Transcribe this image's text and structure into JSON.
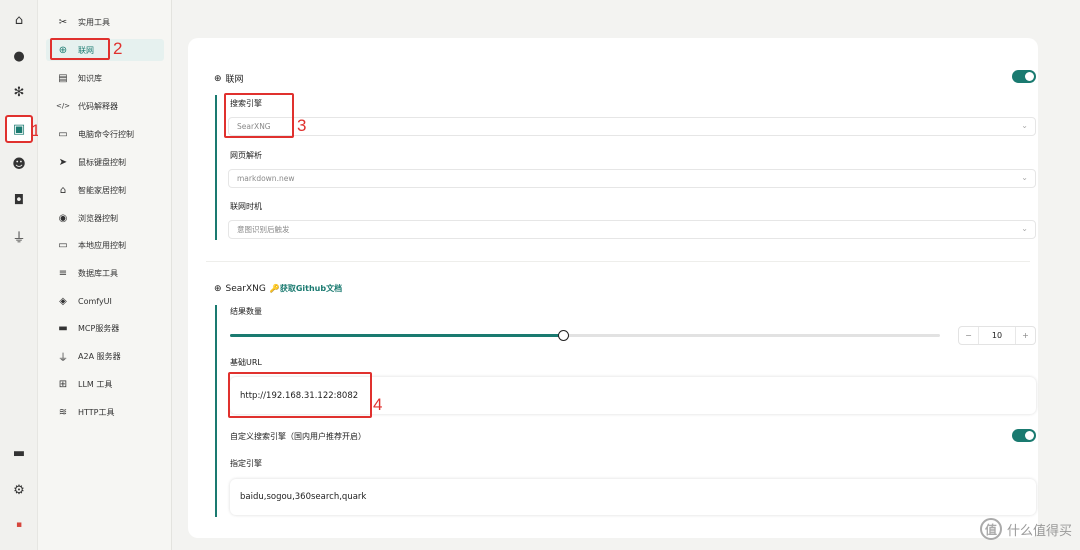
{
  "rail": {
    "items": [
      {
        "name": "home-icon",
        "glyph": "⌂"
      },
      {
        "name": "chat-icon",
        "glyph": "●"
      },
      {
        "name": "settings-snowflake-icon",
        "glyph": "✻"
      },
      {
        "name": "toolbox-icon",
        "glyph": "▣"
      },
      {
        "name": "theater-mask-icon",
        "glyph": "☻"
      },
      {
        "name": "robot-icon",
        "glyph": "◘"
      },
      {
        "name": "plug-icon",
        "glyph": "⏚"
      },
      {
        "name": "archive-icon",
        "glyph": "▬"
      },
      {
        "name": "gear-icon",
        "glyph": "⚙"
      },
      {
        "name": "app-logo-icon",
        "glyph": "▪"
      }
    ]
  },
  "sidebar": {
    "items": [
      {
        "label": "实用工具",
        "icon": "✂"
      },
      {
        "label": "联网",
        "icon": "⊕"
      },
      {
        "label": "知识库",
        "icon": "▤"
      },
      {
        "label": "代码解释器",
        "icon": "</>"
      },
      {
        "label": "电脑命令行控制",
        "icon": "▭"
      },
      {
        "label": "鼠标键盘控制",
        "icon": "➤"
      },
      {
        "label": "智能家居控制",
        "icon": "⌂"
      },
      {
        "label": "浏览器控制",
        "icon": "◉"
      },
      {
        "label": "本地应用控制",
        "icon": "▭"
      },
      {
        "label": "数据库工具",
        "icon": "≡"
      },
      {
        "label": "ComfyUI",
        "icon": "◈"
      },
      {
        "label": "MCP服务器",
        "icon": "▬"
      },
      {
        "label": "A2A 服务器",
        "icon": "⏚"
      },
      {
        "label": "LLM 工具",
        "icon": "⊞"
      },
      {
        "label": "HTTP工具",
        "icon": "≋"
      }
    ]
  },
  "annotations": {
    "a1": "1",
    "a2": "2",
    "a3": "3",
    "a4": "4"
  },
  "web": {
    "title": "联网",
    "engine_label": "搜索引擎",
    "engine_value": "SearXNG",
    "parse_label": "网页解析",
    "parse_value": "markdown.new",
    "timing_label": "联网时机",
    "timing_value": "意图识别后触发"
  },
  "searxng": {
    "title": "SearXNG",
    "doc_link": "获取Github文档",
    "count_label": "结果数量",
    "count_value": "10",
    "count_fraction": 0.47,
    "url_label": "基础URL",
    "url_value": "http://192.168.31.122:8082",
    "custom_label": "自定义搜索引擎（国内用户推荐开启）",
    "engines_label": "指定引擎",
    "engines_value": "baidu,sogou,360search,quark"
  },
  "watermark": {
    "text": "什么值得买",
    "logo": "值"
  },
  "colors": {
    "accent": "#1a7a70",
    "annotation": "#e0312e"
  }
}
